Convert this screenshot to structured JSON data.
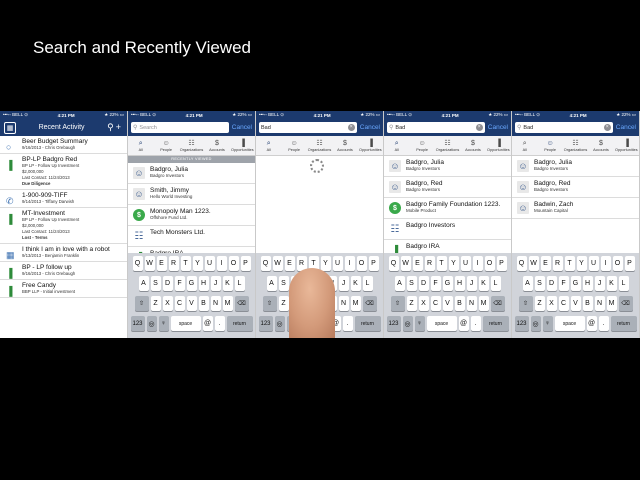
{
  "slide": {
    "title": "Search and Recently Viewed"
  },
  "status": {
    "carrier": "•••◦◦ BELL ⊙",
    "time": "4:21 PM",
    "battery": "★ 22% ▭"
  },
  "recent": {
    "title": "Recent Activity",
    "items": [
      {
        "icon": "beer-icon",
        "glyph": "○",
        "title": "Beer Budget Summary",
        "lines": [
          "9/16/2013 - Chris Orebaugh"
        ]
      },
      {
        "icon": "pipeline-icon",
        "glyph": "▐",
        "title": "BP-LP Badgro Red",
        "lines": [
          "BP LP - Follow Up Investment",
          "$2,000,000",
          "Last Contact: 11/24/2013",
          "Due Diligence"
        ],
        "bold_last": true
      },
      {
        "icon": "phone-icon",
        "glyph": "✆",
        "title": "1-900-909-TIFF",
        "lines": [
          "9/14/2013 - Tiffany Darwish"
        ]
      },
      {
        "icon": "pipeline-icon",
        "glyph": "▐",
        "title": "MT-Investment",
        "lines": [
          "BP LP - Follow Up Investment",
          "$2,000,000",
          "Last Contact: 11/24/2013",
          "Lost - Terms"
        ],
        "bold_last": true
      },
      {
        "icon": "calendar-icon",
        "glyph": "▦",
        "title": "I think I am in love with a robot",
        "lines": [
          "9/13/2013 - Benjamin Franklin"
        ]
      },
      {
        "icon": "pipeline-icon",
        "glyph": "▐",
        "title": "BP - LP follow up",
        "lines": [
          "9/16/2013 - Chris Orebaugh"
        ]
      },
      {
        "icon": "pipeline-icon",
        "glyph": "▐",
        "title": "Free Candy",
        "lines": [
          "BBP LLP - Initial investment"
        ]
      }
    ]
  },
  "search": {
    "placeholder": "Search",
    "query": "Bad",
    "cancel": "Cancel",
    "tabs": [
      "All",
      "People",
      "Organizations",
      "Accounts",
      "Opportunities"
    ],
    "recently_viewed_header": "RECENTLY VIEWED"
  },
  "panel2": {
    "rows": [
      {
        "kind": "person",
        "title": "Badgro, Julia",
        "sub": "Badgro Investors"
      },
      {
        "kind": "person",
        "title": "Smith, Jimmy",
        "sub": "Hello World Investing"
      },
      {
        "kind": "money",
        "title": "Monopoly Man 1223.",
        "sub": "Offshore Fund Ltd."
      },
      {
        "kind": "org",
        "title": "Tech Monsters Ltd.",
        "sub": ""
      },
      {
        "kind": "green",
        "title": "Badgro IRA",
        "sub": ""
      }
    ]
  },
  "panel4": {
    "rows": [
      {
        "kind": "person",
        "title": "Badgro, Julia",
        "sub": "Badgro Investors"
      },
      {
        "kind": "person",
        "title": "Badgro, Red",
        "sub": "Badgro Investors"
      },
      {
        "kind": "money",
        "title": "Badgro Family Foundation 1223.",
        "sub": "Mobile Product"
      },
      {
        "kind": "org",
        "title": "Badgro Investors",
        "sub": ""
      },
      {
        "kind": "green",
        "title": "Badgro IRA",
        "sub": ""
      }
    ]
  },
  "panel5": {
    "rows": [
      {
        "kind": "person",
        "title": "Badgro, Julia",
        "sub": "Badgro Investors"
      },
      {
        "kind": "person",
        "title": "Badgro, Red",
        "sub": "Badgro Investors"
      },
      {
        "kind": "person",
        "title": "Badwin, Zach",
        "sub": "Mountain Capital"
      }
    ]
  },
  "keyboard": {
    "row1": [
      "Q",
      "W",
      "E",
      "R",
      "T",
      "Y",
      "U",
      "I",
      "O",
      "P"
    ],
    "row2": [
      "A",
      "S",
      "D",
      "F",
      "G",
      "H",
      "J",
      "K",
      "L"
    ],
    "row3": [
      "Z",
      "X",
      "C",
      "V",
      "B",
      "N",
      "M"
    ],
    "shift": "⇧",
    "delete": "⌫",
    "numbers": "123",
    "globe": "◎",
    "mic": "♀",
    "space": "space",
    "at": "@",
    "dot": ".",
    "return": "return"
  }
}
